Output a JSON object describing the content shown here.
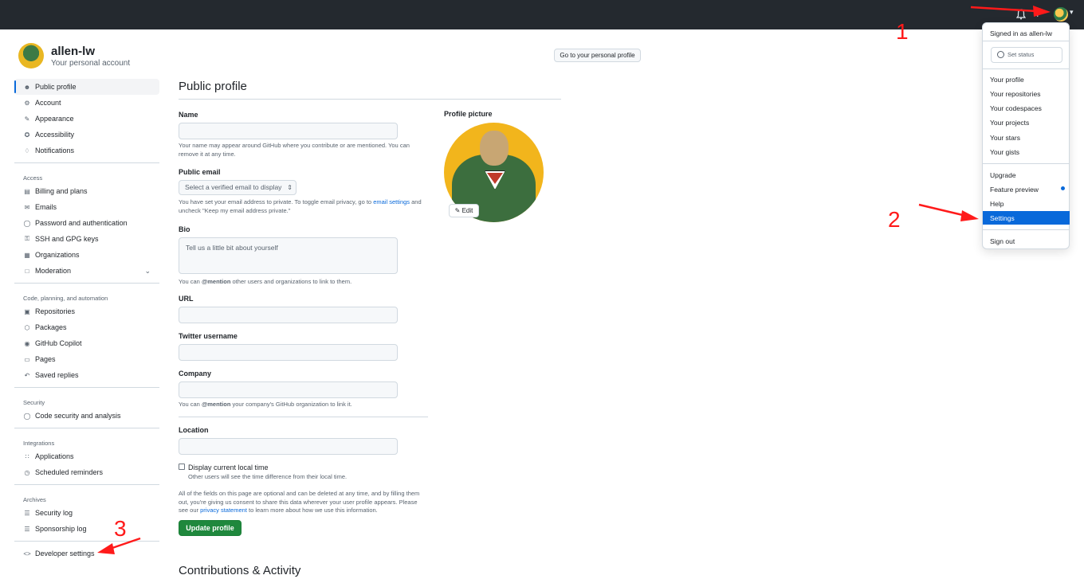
{
  "header": {
    "plus_icon": "+",
    "caret": "▾"
  },
  "account": {
    "username": "allen-lw",
    "subtitle": "Your personal account",
    "go_profile": "Go to your personal profile"
  },
  "sidebar": {
    "items_top": [
      "Public profile",
      "Account",
      "Appearance",
      "Accessibility",
      "Notifications"
    ],
    "access_label": "Access",
    "items_access": [
      "Billing and plans",
      "Emails",
      "Password and authentication",
      "SSH and GPG keys",
      "Organizations",
      "Moderation"
    ],
    "code_label": "Code, planning, and automation",
    "items_code": [
      "Repositories",
      "Packages",
      "GitHub Copilot",
      "Pages",
      "Saved replies"
    ],
    "security_label": "Security",
    "items_security": [
      "Code security and analysis"
    ],
    "integrations_label": "Integrations",
    "items_integrations": [
      "Applications",
      "Scheduled reminders"
    ],
    "archives_label": "Archives",
    "items_archives": [
      "Security log",
      "Sponsorship log"
    ],
    "developer": "Developer settings"
  },
  "form": {
    "title": "Public profile",
    "name_label": "Name",
    "name_note": "Your name may appear around GitHub where you contribute or are mentioned. You can remove it at any time.",
    "email_label": "Public email",
    "email_select": "Select a verified email to display",
    "email_note_a": "You have set your email address to private. To toggle email privacy, go to",
    "email_note_link": "email settings",
    "email_note_b": "and uncheck \"Keep my email address private.\"",
    "bio_label": "Bio",
    "bio_placeholder": "Tell us a little bit about yourself",
    "bio_note_a": "You can",
    "bio_note_mention": "@mention",
    "bio_note_b": "other users and organizations to link to them.",
    "url_label": "URL",
    "twitter_label": "Twitter username",
    "company_label": "Company",
    "company_note_a": "You can",
    "company_note_mention": "@mention",
    "company_note_b": "your company's GitHub organization to link it.",
    "location_label": "Location",
    "localtime_label": "Display current local time",
    "localtime_note": "Other users will see the time difference from their local time.",
    "consent_a": "All of the fields on this page are optional and can be deleted at any time, and by filling them out, you're giving us consent to share this data wherever your user profile appears. Please see our",
    "consent_link": "privacy statement",
    "consent_b": "to learn more about how we use this information.",
    "update_button": "Update profile",
    "contrib_title": "Contributions & Activity"
  },
  "picture": {
    "label": "Profile picture",
    "edit": "Edit"
  },
  "menu": {
    "signed_in": "Signed in as allen-lw",
    "set_status": "Set status",
    "items_a": [
      "Your profile",
      "Your repositories",
      "Your codespaces",
      "Your projects",
      "Your stars",
      "Your gists"
    ],
    "items_b": [
      "Upgrade",
      "Feature preview",
      "Help",
      "Settings"
    ],
    "sign_out": "Sign out"
  },
  "annotations": {
    "n1": "1",
    "n2": "2",
    "n3": "3",
    "color": "#ff1a1a"
  }
}
